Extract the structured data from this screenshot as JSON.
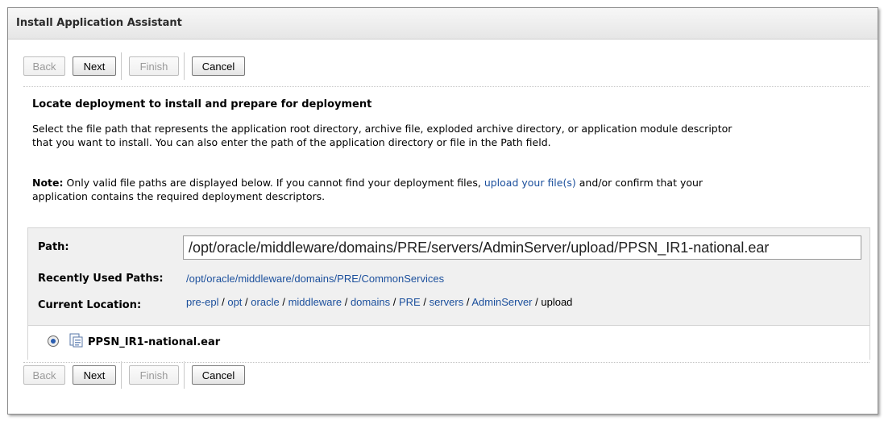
{
  "title": "Install Application Assistant",
  "buttons": {
    "back": "Back",
    "next": "Next",
    "finish": "Finish",
    "cancel": "Cancel"
  },
  "heading": "Locate deployment to install and prepare for deployment",
  "description": {
    "line1": "Select the file path that represents the application root directory, archive file, exploded archive directory, or application module descriptor",
    "line2": "that you want to install. You can also enter the path of the application directory or file in the Path field."
  },
  "note": {
    "label": "Note:",
    "text_before": "Only valid file paths are displayed below. If you cannot find your deployment files,",
    "link": "upload your file(s)",
    "text_after": "and/or confirm that your",
    "line2": "application contains the required deployment descriptors."
  },
  "path": {
    "label": "Path:",
    "value": "/opt/oracle/middleware/domains/PRE/servers/AdminServer/upload/PPSN_IR1-national.ear"
  },
  "recent": {
    "label": "Recently Used Paths:",
    "value": "/opt/oracle/middleware/domains/PRE/CommonServices"
  },
  "location": {
    "label": "Current Location:",
    "crumbs": [
      "pre-epl",
      "opt",
      "oracle",
      "middleware",
      "domains",
      "PRE",
      "servers",
      "AdminServer",
      "upload"
    ],
    "separator": "/"
  },
  "file": {
    "name": "PPSN_IR1-national.ear",
    "selected": true
  },
  "icons": {
    "radio": "radio-selected-icon",
    "file": "archive-file-icon"
  }
}
